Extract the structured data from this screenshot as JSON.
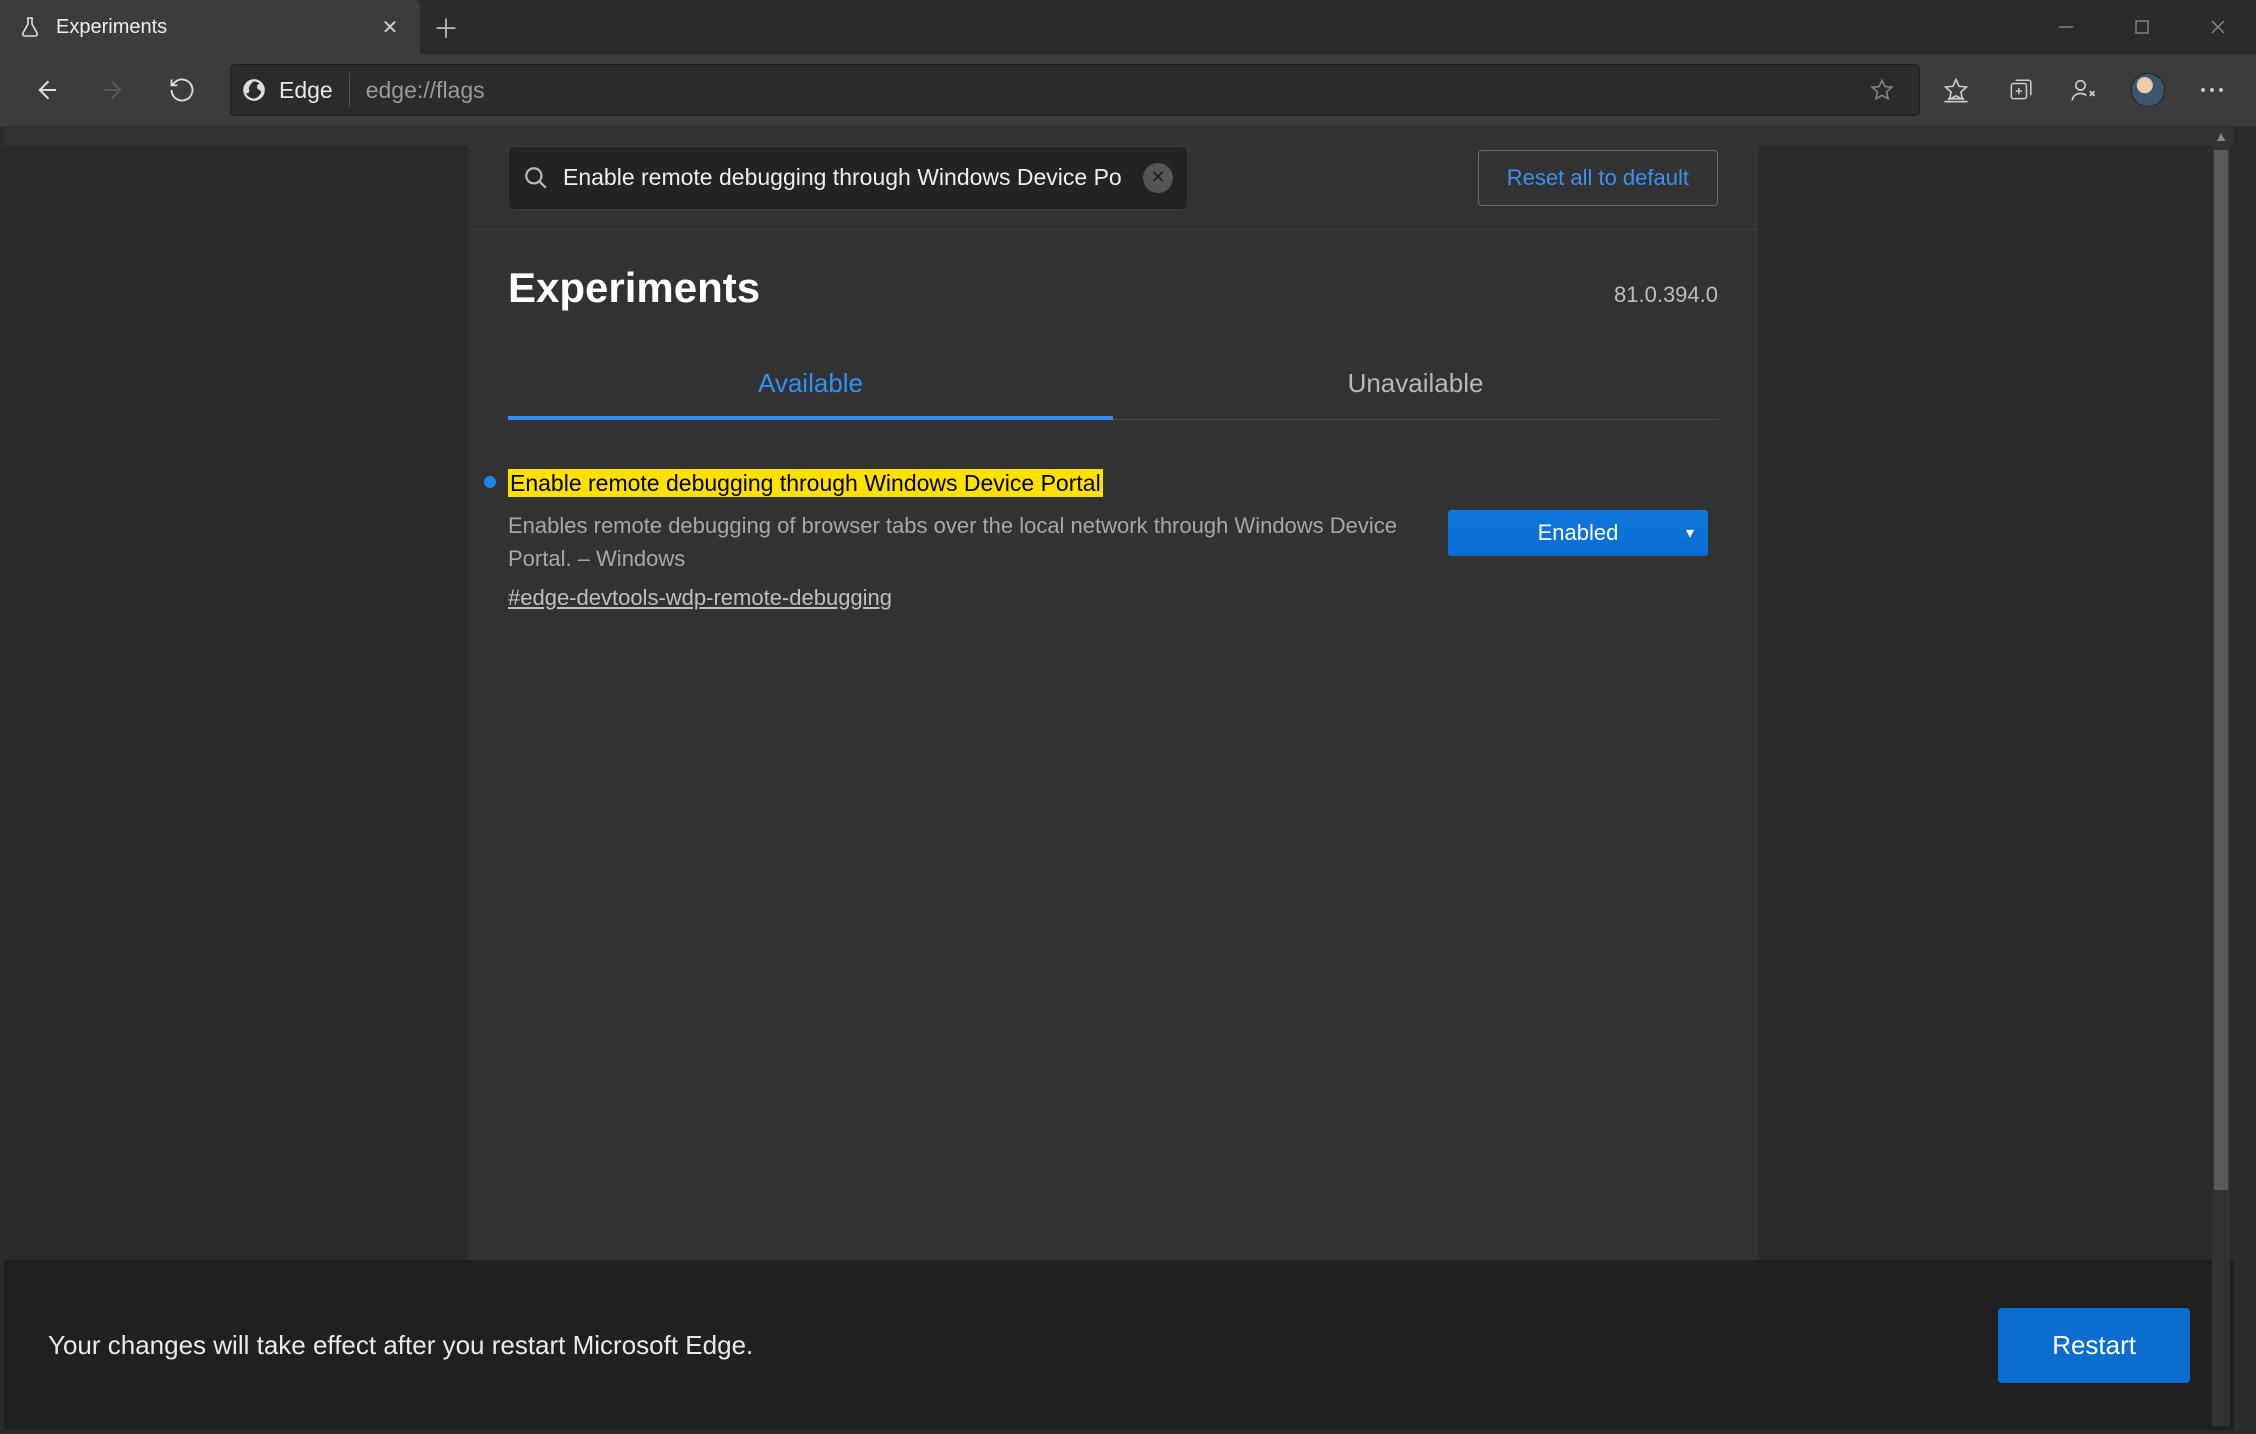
{
  "window": {
    "tab_title": "Experiments"
  },
  "toolbar": {
    "site_label": "Edge",
    "url": "edge://flags"
  },
  "page": {
    "search_value": "Enable remote debugging through Windows Device Po",
    "reset_label": "Reset all to default",
    "heading": "Experiments",
    "version": "81.0.394.0",
    "tabs": {
      "available": "Available",
      "unavailable": "Unavailable"
    },
    "flag": {
      "title": "Enable remote debugging through Windows Device Portal",
      "description": "Enables remote debugging of browser tabs over the local network through Windows Device Portal. – Windows",
      "anchor": "#edge-devtools-wdp-remote-debugging",
      "select_value": "Enabled"
    }
  },
  "restart": {
    "message": "Your changes will take effect after you restart Microsoft Edge.",
    "button": "Restart"
  }
}
